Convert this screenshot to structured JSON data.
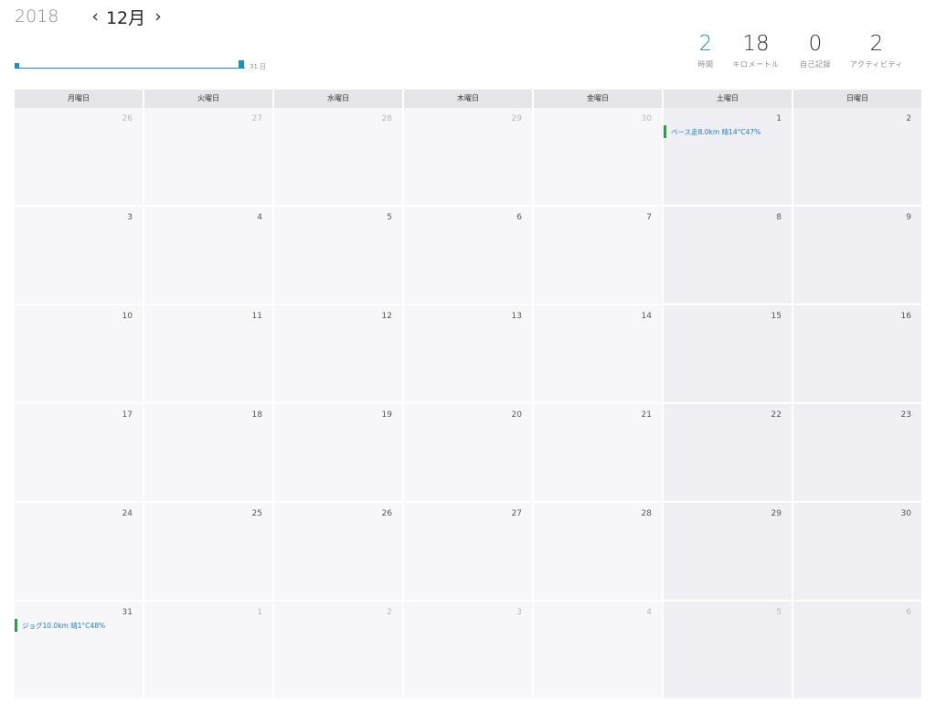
{
  "header": {
    "year": "2018",
    "month": "12月",
    "prev_arrow": "‹",
    "next_arrow": "›"
  },
  "timeline": {
    "end_label": "31 日"
  },
  "stats": [
    {
      "value": "2",
      "label": "時間",
      "accent": true
    },
    {
      "value": "18",
      "label": "キロメートル",
      "accent": false
    },
    {
      "value": "0",
      "label": "自己記録",
      "accent": false
    },
    {
      "value": "2",
      "label": "アクティビティ",
      "accent": false
    }
  ],
  "weekdays": [
    "月曜日",
    "火曜日",
    "水曜日",
    "木曜日",
    "金曜日",
    "土曜日",
    "日曜日"
  ],
  "weeks": [
    [
      {
        "day": "26",
        "other": true
      },
      {
        "day": "27",
        "other": true
      },
      {
        "day": "28",
        "other": true
      },
      {
        "day": "29",
        "other": true
      },
      {
        "day": "30",
        "other": true
      },
      {
        "day": "1",
        "other": false,
        "event": "ペース走8.0km 晴14°C47%"
      },
      {
        "day": "2",
        "other": false
      }
    ],
    [
      {
        "day": "3"
      },
      {
        "day": "4"
      },
      {
        "day": "5"
      },
      {
        "day": "6"
      },
      {
        "day": "7"
      },
      {
        "day": "8"
      },
      {
        "day": "9"
      }
    ],
    [
      {
        "day": "10"
      },
      {
        "day": "11"
      },
      {
        "day": "12"
      },
      {
        "day": "13"
      },
      {
        "day": "14"
      },
      {
        "day": "15"
      },
      {
        "day": "16"
      }
    ],
    [
      {
        "day": "17"
      },
      {
        "day": "18"
      },
      {
        "day": "19"
      },
      {
        "day": "20"
      },
      {
        "day": "21"
      },
      {
        "day": "22"
      },
      {
        "day": "23"
      }
    ],
    [
      {
        "day": "24"
      },
      {
        "day": "25"
      },
      {
        "day": "26"
      },
      {
        "day": "27"
      },
      {
        "day": "28"
      },
      {
        "day": "29"
      },
      {
        "day": "30"
      }
    ],
    [
      {
        "day": "31",
        "other": false,
        "event": "ジョグ10.0km 晴1°C48%"
      },
      {
        "day": "1",
        "other": true
      },
      {
        "day": "2",
        "other": true
      },
      {
        "day": "3",
        "other": true
      },
      {
        "day": "4",
        "other": true
      },
      {
        "day": "5",
        "other": true
      },
      {
        "day": "6",
        "other": true
      }
    ]
  ],
  "colors": {
    "accent": "#1a8fc9",
    "event_bar": "#26a046",
    "event_text": "#1a7fbf"
  }
}
